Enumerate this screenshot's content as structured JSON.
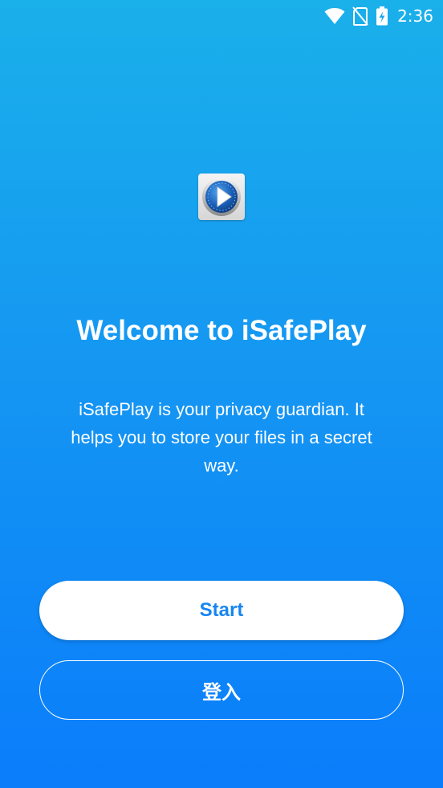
{
  "status_bar": {
    "time": "2:36",
    "icons": [
      "wifi-icon",
      "no-sim-icon",
      "battery-charging-icon"
    ]
  },
  "app": {
    "logo_icon": "play-logo-icon"
  },
  "welcome": {
    "title": "Welcome to iSafePlay",
    "description": "iSafePlay is your privacy guardian. It helps you to store your files in a secret way."
  },
  "actions": {
    "start_label": "Start",
    "login_label": "登入"
  },
  "colors": {
    "gradient_top": "#1ab0ea",
    "gradient_bottom": "#0a7dfb",
    "start_text": "#1786f0",
    "white": "#ffffff"
  }
}
